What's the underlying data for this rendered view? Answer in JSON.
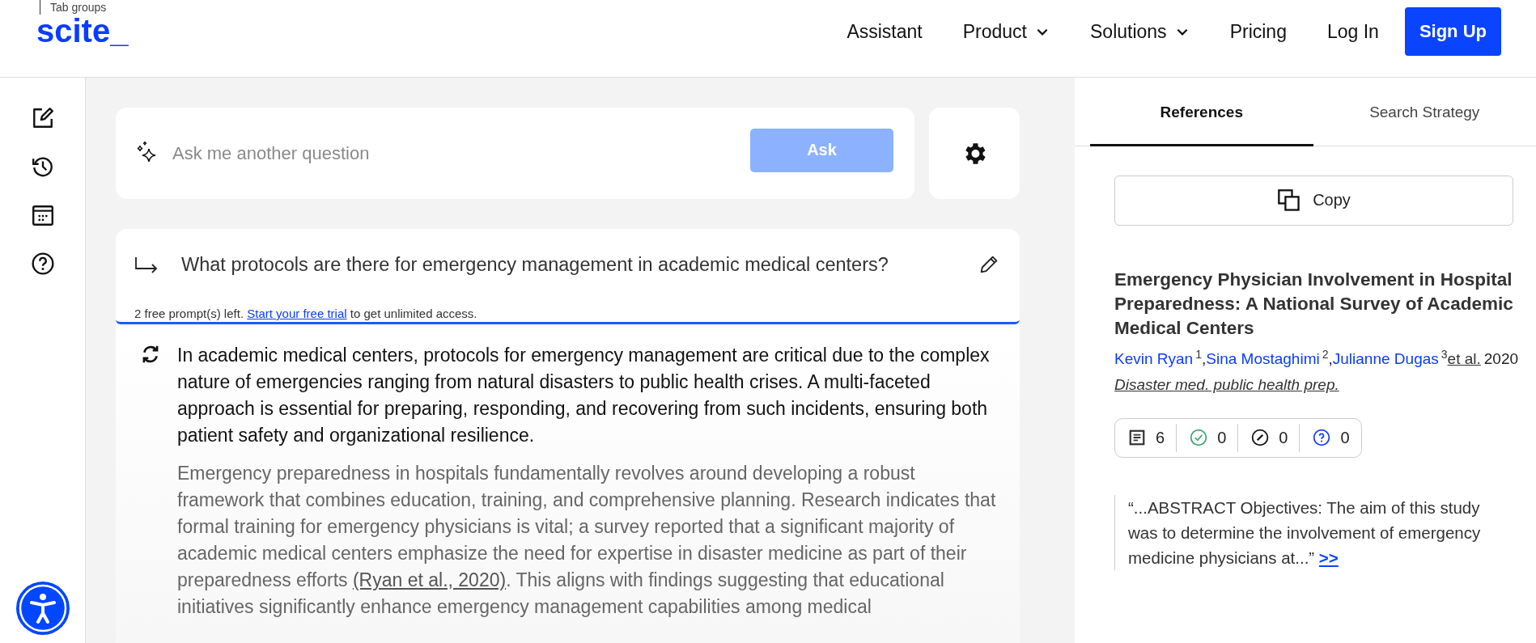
{
  "header": {
    "tab_groups_label": "Tab groups",
    "logo": "scite_",
    "nav": [
      {
        "label": "Assistant",
        "dropdown": false
      },
      {
        "label": "Product",
        "dropdown": true
      },
      {
        "label": "Solutions",
        "dropdown": true
      },
      {
        "label": "Pricing",
        "dropdown": false
      },
      {
        "label": "Log In",
        "dropdown": false
      }
    ],
    "signup": "Sign Up"
  },
  "ask": {
    "placeholder": "Ask me another question",
    "button": "Ask"
  },
  "question": {
    "text": "What protocols are there for emergency management in academic medical centers?",
    "notice_before": "2 free prompt(s) left.",
    "notice_link": "Start your free trial",
    "notice_after": "to get unlimited access."
  },
  "answer": {
    "paragraphs": [
      {
        "kind": "lead",
        "parts": [
          {
            "kind": "text",
            "text": "In academic medical centers, protocols for emergency management are critical due to the complex nature of emergencies ranging from natural disasters to public health crises. A multi-faceted approach is essential for preparing, responding, and recovering from such incidents, ensuring both patient safety and organizational resilience."
          }
        ]
      },
      {
        "kind": "body",
        "parts": [
          {
            "kind": "text",
            "text": "Emergency preparedness in hospitals fundamentally revolves around developing a robust framework that combines education, training, and comprehensive planning. Research indicates that formal training for emergency physicians is vital; a survey reported that a significant majority of academic medical centers emphasize the need for expertise in disaster medicine as part of their preparedness efforts "
          },
          {
            "kind": "citation",
            "text": "(Ryan et al., 2020)"
          },
          {
            "kind": "text",
            "text": ". This aligns with findings suggesting that educational initiatives significantly enhance emergency management capabilities among medical"
          }
        ]
      }
    ]
  },
  "panel": {
    "tabs": [
      {
        "label": "References",
        "selected": true
      },
      {
        "label": "Search Strategy",
        "selected": false
      }
    ],
    "copy": "Copy",
    "reference": {
      "title": "Emergency Physician Involvement in Hospital Preparedness: A National Survey of Academic Medical Centers",
      "authors": [
        {
          "name": "Kevin Ryan",
          "sup": "1",
          "separator": ","
        },
        {
          "name": "Sina Mostaghimi",
          "sup": "2",
          "separator": ","
        },
        {
          "name": "Julianne Dugas",
          "sup": "3"
        }
      ],
      "et_al": "et al.",
      "year": "2020",
      "journal": "Disaster med. public health prep.",
      "counts": [
        {
          "kind": "mentioning",
          "value": "6"
        },
        {
          "kind": "supporting",
          "value": "0"
        },
        {
          "kind": "contrasting",
          "value": "0"
        },
        {
          "kind": "unclassified",
          "value": "0"
        }
      ],
      "quote": "“...ABSTRACT Objectives: The aim of this study was to determine the involvement of emergency medicine physicians at...”",
      "quote_link": ">>"
    }
  }
}
